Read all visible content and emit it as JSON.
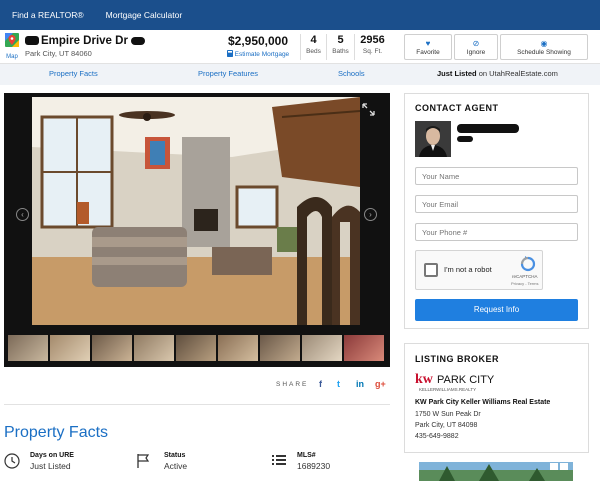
{
  "topnav": {
    "links": [
      "Find a REALTOR®",
      "Mortgage Calculator"
    ]
  },
  "listing": {
    "map_label": "Map",
    "street": "Empire Drive Dr",
    "city_line": "Park City, UT 84060",
    "price": "$2,950,000",
    "estimate_link": "Estimate Mortgage",
    "beds": "4",
    "beds_label": "Beds",
    "baths": "5",
    "baths_label": "Baths",
    "sqft": "2956",
    "sqft_label": "Sq. Ft."
  },
  "actions": {
    "favorite": "Favorite",
    "ignore": "Ignore",
    "schedule": "Schedule Showing"
  },
  "subnav": {
    "tabs": [
      "Property Facts",
      "Property Features",
      "Schools"
    ],
    "just_listed": "Just Listed",
    "source": "on UtahRealEstate.com"
  },
  "gallery": {
    "thumbnail_count": 9
  },
  "share": {
    "label": "SHARE",
    "networks": [
      "f",
      "t",
      "in",
      "g+"
    ]
  },
  "facts": {
    "title": "Property Facts",
    "items": [
      {
        "label": "Days on URE",
        "value": "Just Listed",
        "icon": "clock-icon"
      },
      {
        "label": "Status",
        "value": "Active",
        "icon": "flag-icon"
      },
      {
        "label": "MLS#",
        "value": "1689230",
        "icon": "list-icon"
      }
    ]
  },
  "contact": {
    "heading": "CONTACT AGENT",
    "name_placeholder": "Your Name",
    "email_placeholder": "Your Email",
    "phone_placeholder": "Your Phone #",
    "captcha_label": "I'm not a robot",
    "captcha_brand": "reCAPTCHA",
    "captcha_links": "Privacy - Terms",
    "submit": "Request Info"
  },
  "broker": {
    "heading": "LISTING BROKER",
    "logo_kw": "kw",
    "logo_city": "PARK CITY",
    "logo_sub": "KELLERWILLIAMS.REALTY",
    "name": "KW Park City Keller Williams Real Estate",
    "address1": "1750 W Sun Peak Dr",
    "address2": "Park City, UT 84098",
    "phone": "435-649-9882"
  },
  "colors": {
    "brand_blue": "#1b4f8c",
    "link_blue": "#1b6fc4",
    "button_blue": "#1f7fe0",
    "kw_red": "#c8102e"
  }
}
